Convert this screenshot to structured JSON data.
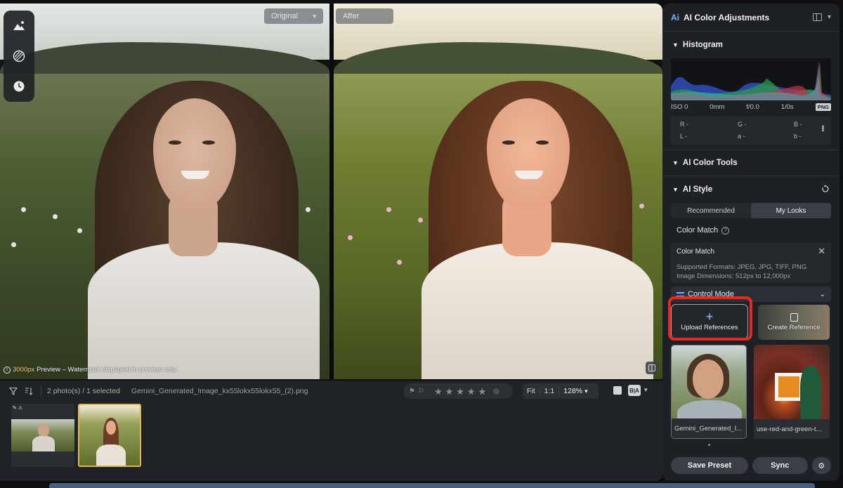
{
  "viewer": {
    "original_label": "Original",
    "after_label": "After",
    "preview_px": "3000px",
    "preview_note": " Preview – Watermark displayed in preview only."
  },
  "toolbar_left": {
    "icons": [
      "mountain-icon",
      "texture-icon",
      "history-icon"
    ]
  },
  "filmstrip": {
    "count_text": "2 photo(s) / 1 selected",
    "file_name": "Gemini_Generated_Image_kx55lokx55lokx55_(2).png",
    "zoom_fit": "Fit",
    "zoom_1to1": "1:1",
    "zoom_value": "128%",
    "ba_label": "B|A",
    "rating": 0
  },
  "panel": {
    "title": "AI Color Adjustments",
    "ai_badge": "Ai",
    "histogram": {
      "title": "Histogram",
      "iso": "ISO 0",
      "focal": "0mm",
      "aperture": "f/0.0",
      "shutter": "1/0s",
      "format": "PNG",
      "readout": {
        "r": "R -",
        "g": "G -",
        "b": "B -",
        "l": "L -",
        "a": "a -",
        "b2": "b -"
      }
    },
    "color_tools_title": "AI Color Tools",
    "style": {
      "title": "AI Style",
      "tab_recommended": "Recommended",
      "tab_my_looks": "My Looks",
      "active_tab": "My Looks",
      "color_match_label": "Color Match",
      "card_title": "Color Match",
      "card_formats": "Supported Formats: JPEG, JPG, TIFF, PNG",
      "card_dimensions": "Image Dimensions: 512px to 12,000px",
      "control_mode": "Control Mode",
      "upload_label": "Upload References",
      "create_label": "Create Reference",
      "references": [
        {
          "name": "Gemini_Generated_I..."
        },
        {
          "name": "use-red-and-green-t..."
        }
      ]
    },
    "footer": {
      "save_preset": "Save Preset",
      "sync": "Sync"
    }
  },
  "colors": {
    "accent_blue": "#7fb0ff",
    "highlight_red": "#e8281e",
    "selected_thumb": "#e2b64a"
  }
}
